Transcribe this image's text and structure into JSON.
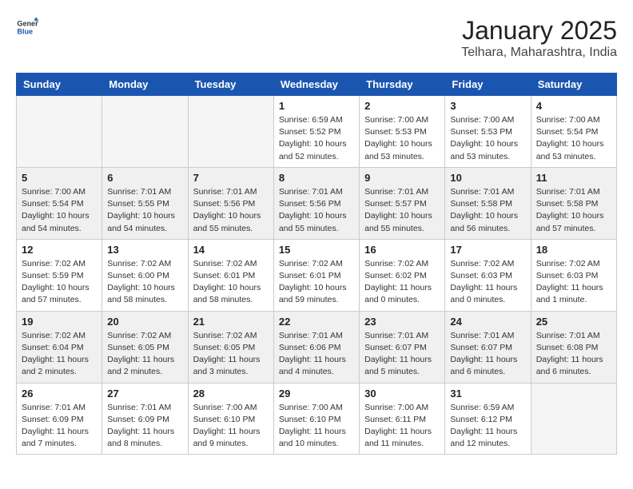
{
  "header": {
    "logo_line1": "General",
    "logo_line2": "Blue",
    "month_title": "January 2025",
    "location": "Telhara, Maharashtra, India"
  },
  "weekdays": [
    "Sunday",
    "Monday",
    "Tuesday",
    "Wednesday",
    "Thursday",
    "Friday",
    "Saturday"
  ],
  "weeks": [
    [
      {
        "day": "",
        "info": ""
      },
      {
        "day": "",
        "info": ""
      },
      {
        "day": "",
        "info": ""
      },
      {
        "day": "1",
        "info": "Sunrise: 6:59 AM\nSunset: 5:52 PM\nDaylight: 10 hours\nand 52 minutes."
      },
      {
        "day": "2",
        "info": "Sunrise: 7:00 AM\nSunset: 5:53 PM\nDaylight: 10 hours\nand 53 minutes."
      },
      {
        "day": "3",
        "info": "Sunrise: 7:00 AM\nSunset: 5:53 PM\nDaylight: 10 hours\nand 53 minutes."
      },
      {
        "day": "4",
        "info": "Sunrise: 7:00 AM\nSunset: 5:54 PM\nDaylight: 10 hours\nand 53 minutes."
      }
    ],
    [
      {
        "day": "5",
        "info": "Sunrise: 7:00 AM\nSunset: 5:54 PM\nDaylight: 10 hours\nand 54 minutes."
      },
      {
        "day": "6",
        "info": "Sunrise: 7:01 AM\nSunset: 5:55 PM\nDaylight: 10 hours\nand 54 minutes."
      },
      {
        "day": "7",
        "info": "Sunrise: 7:01 AM\nSunset: 5:56 PM\nDaylight: 10 hours\nand 55 minutes."
      },
      {
        "day": "8",
        "info": "Sunrise: 7:01 AM\nSunset: 5:56 PM\nDaylight: 10 hours\nand 55 minutes."
      },
      {
        "day": "9",
        "info": "Sunrise: 7:01 AM\nSunset: 5:57 PM\nDaylight: 10 hours\nand 55 minutes."
      },
      {
        "day": "10",
        "info": "Sunrise: 7:01 AM\nSunset: 5:58 PM\nDaylight: 10 hours\nand 56 minutes."
      },
      {
        "day": "11",
        "info": "Sunrise: 7:01 AM\nSunset: 5:58 PM\nDaylight: 10 hours\nand 57 minutes."
      }
    ],
    [
      {
        "day": "12",
        "info": "Sunrise: 7:02 AM\nSunset: 5:59 PM\nDaylight: 10 hours\nand 57 minutes."
      },
      {
        "day": "13",
        "info": "Sunrise: 7:02 AM\nSunset: 6:00 PM\nDaylight: 10 hours\nand 58 minutes."
      },
      {
        "day": "14",
        "info": "Sunrise: 7:02 AM\nSunset: 6:01 PM\nDaylight: 10 hours\nand 58 minutes."
      },
      {
        "day": "15",
        "info": "Sunrise: 7:02 AM\nSunset: 6:01 PM\nDaylight: 10 hours\nand 59 minutes."
      },
      {
        "day": "16",
        "info": "Sunrise: 7:02 AM\nSunset: 6:02 PM\nDaylight: 11 hours\nand 0 minutes."
      },
      {
        "day": "17",
        "info": "Sunrise: 7:02 AM\nSunset: 6:03 PM\nDaylight: 11 hours\nand 0 minutes."
      },
      {
        "day": "18",
        "info": "Sunrise: 7:02 AM\nSunset: 6:03 PM\nDaylight: 11 hours\nand 1 minute."
      }
    ],
    [
      {
        "day": "19",
        "info": "Sunrise: 7:02 AM\nSunset: 6:04 PM\nDaylight: 11 hours\nand 2 minutes."
      },
      {
        "day": "20",
        "info": "Sunrise: 7:02 AM\nSunset: 6:05 PM\nDaylight: 11 hours\nand 2 minutes."
      },
      {
        "day": "21",
        "info": "Sunrise: 7:02 AM\nSunset: 6:05 PM\nDaylight: 11 hours\nand 3 minutes."
      },
      {
        "day": "22",
        "info": "Sunrise: 7:01 AM\nSunset: 6:06 PM\nDaylight: 11 hours\nand 4 minutes."
      },
      {
        "day": "23",
        "info": "Sunrise: 7:01 AM\nSunset: 6:07 PM\nDaylight: 11 hours\nand 5 minutes."
      },
      {
        "day": "24",
        "info": "Sunrise: 7:01 AM\nSunset: 6:07 PM\nDaylight: 11 hours\nand 6 minutes."
      },
      {
        "day": "25",
        "info": "Sunrise: 7:01 AM\nSunset: 6:08 PM\nDaylight: 11 hours\nand 6 minutes."
      }
    ],
    [
      {
        "day": "26",
        "info": "Sunrise: 7:01 AM\nSunset: 6:09 PM\nDaylight: 11 hours\nand 7 minutes."
      },
      {
        "day": "27",
        "info": "Sunrise: 7:01 AM\nSunset: 6:09 PM\nDaylight: 11 hours\nand 8 minutes."
      },
      {
        "day": "28",
        "info": "Sunrise: 7:00 AM\nSunset: 6:10 PM\nDaylight: 11 hours\nand 9 minutes."
      },
      {
        "day": "29",
        "info": "Sunrise: 7:00 AM\nSunset: 6:10 PM\nDaylight: 11 hours\nand 10 minutes."
      },
      {
        "day": "30",
        "info": "Sunrise: 7:00 AM\nSunset: 6:11 PM\nDaylight: 11 hours\nand 11 minutes."
      },
      {
        "day": "31",
        "info": "Sunrise: 6:59 AM\nSunset: 6:12 PM\nDaylight: 11 hours\nand 12 minutes."
      },
      {
        "day": "",
        "info": ""
      }
    ]
  ]
}
